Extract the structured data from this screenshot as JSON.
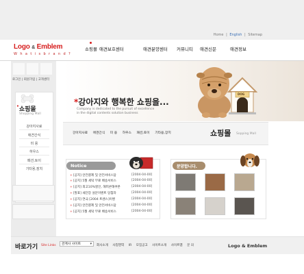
{
  "utility": {
    "home": "Home",
    "sep": "|",
    "english": "English",
    "sitemap": "Sitemap"
  },
  "logo": {
    "part1": "Logo ",
    "amp": "&",
    "part2": " Emblem",
    "tagline": "W h a t  i s  b r a n d ?"
  },
  "nav": [
    "쇼핑몰",
    "애견보호센터",
    "애견분양센터",
    "커뮤니티",
    "애견신문",
    "애견정보"
  ],
  "sublinks": "로그인 | 회원가입 | 고객센터",
  "sidebar": {
    "title": "쇼핑몰",
    "subtitle": "Shopping Mall",
    "items": [
      "강아지사료",
      "애견간식",
      "미 용",
      "하우스",
      "패션,토이",
      "기타용,장치"
    ]
  },
  "hero": {
    "mark": "*",
    "title": "강아지와 행복한 쇼핑을...",
    "desc_line1": "Company is dedicated to the pursuit of excellence",
    "desc_line2": "in the digital contents solution business",
    "sign": "DOG"
  },
  "categories": [
    "강아지사료",
    "애견간식",
    "미 용",
    "하우스",
    "패션,토이",
    "기타용,장치"
  ],
  "shop": {
    "title": "쇼핑몰",
    "subtitle": "Sopping Mall"
  },
  "notice": {
    "title": "Notice",
    "rows": [
      {
        "text": "[공지] 안전결제 및 안전서비스답",
        "date": "[2004-04-00]"
      },
      {
        "text": "[공지] 5월 세탁 무료 배송서비스",
        "date": "[2004-04-00]"
      },
      {
        "text": "[공지] 최고10%할인, 해피콘해쿠폰",
        "date": "[2004-04-00]"
      },
      {
        "text": "[발표] 새단장 설문이벤트 당첨자",
        "date": "[2004-04-00]"
      },
      {
        "text": "[공지] 연극 [2004 트렌스]이벤",
        "date": "[2004-04-00]"
      },
      {
        "text": "[공지] 안전결제 및 안전서비스답",
        "date": "[2004-04-00]"
      },
      {
        "text": "[공지] 5월 세탁 무료 배송서비스",
        "date": "[2004-04-00]"
      }
    ]
  },
  "adoption": {
    "title": "분양합니다."
  },
  "footer": {
    "title": "바로가기",
    "subtitle": "Site Links",
    "select": "관계사 사이트",
    "links": [
      "회사소개",
      "사업영역",
      "IR",
      "모집공고",
      "사이트소개",
      "사이트맵",
      "문 의"
    ],
    "logo": "Logo & Emblem"
  },
  "colors": {
    "accent": "#d61c1c",
    "notice_head": "#9a9a9a",
    "adopt_head": "#a88d6d",
    "topbar": "#efefef"
  }
}
